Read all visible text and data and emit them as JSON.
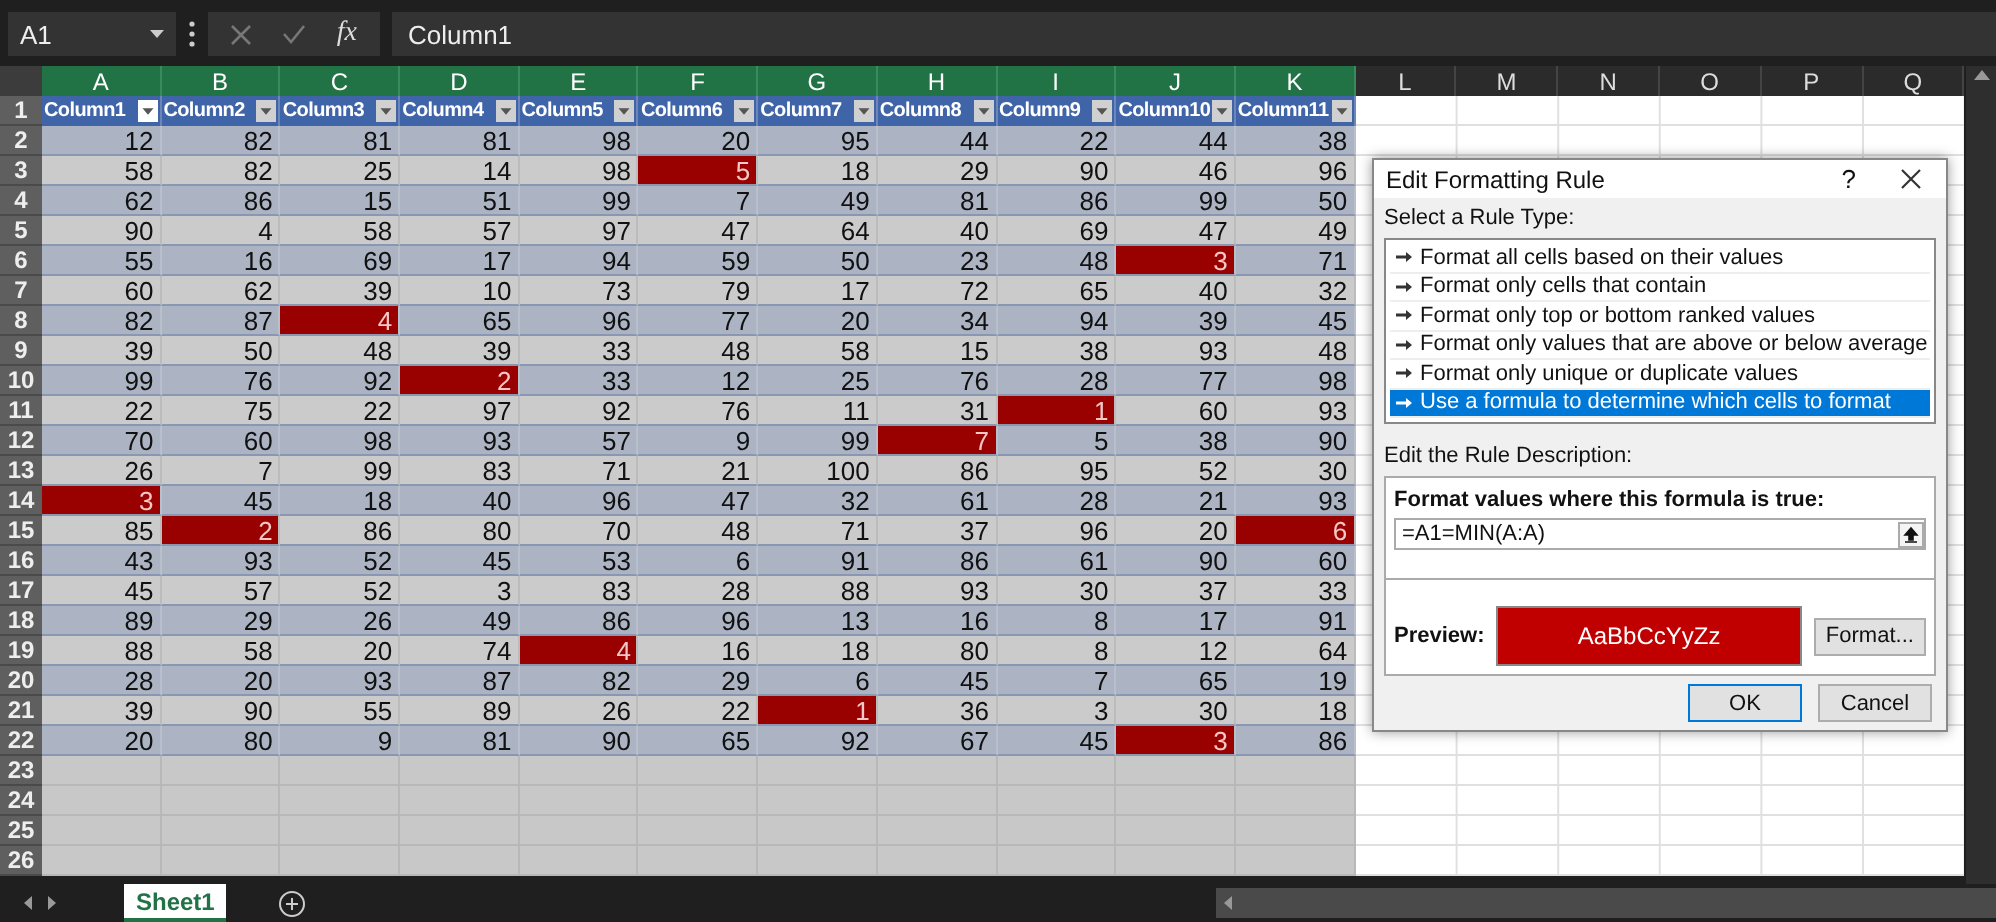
{
  "formula_bar": {
    "name_box": "A1",
    "function_label": "fx",
    "value": "Column1"
  },
  "column_headers": [
    {
      "label": "A",
      "selected": true
    },
    {
      "label": "B",
      "selected": true
    },
    {
      "label": "C",
      "selected": true
    },
    {
      "label": "D",
      "selected": true
    },
    {
      "label": "E",
      "selected": true
    },
    {
      "label": "F",
      "selected": true
    },
    {
      "label": "G",
      "selected": true
    },
    {
      "label": "H",
      "selected": true
    },
    {
      "label": "I",
      "selected": true
    },
    {
      "label": "J",
      "selected": true
    },
    {
      "label": "K",
      "selected": true
    },
    {
      "label": "L",
      "selected": false
    },
    {
      "label": "M",
      "selected": false
    },
    {
      "label": "N",
      "selected": false
    },
    {
      "label": "O",
      "selected": false
    },
    {
      "label": "P",
      "selected": false
    },
    {
      "label": "Q",
      "selected": false
    }
  ],
  "row_headers": [
    "1",
    "2",
    "3",
    "4",
    "5",
    "6",
    "7",
    "8",
    "9",
    "10",
    "11",
    "12",
    "13",
    "14",
    "15",
    "16",
    "17",
    "18",
    "19",
    "20",
    "21",
    "22",
    "23",
    "24",
    "25",
    "26"
  ],
  "table": {
    "columns": [
      "Column1",
      "Column2",
      "Column3",
      "Column4",
      "Column5",
      "Column6",
      "Column7",
      "Column8",
      "Column9",
      "Column10",
      "Column11"
    ],
    "rows": [
      {
        "cells": [
          {
            "value": "12",
            "highlighted": false
          },
          {
            "value": "82",
            "highlighted": false
          },
          {
            "value": "81",
            "highlighted": false
          },
          {
            "value": "81",
            "highlighted": false
          },
          {
            "value": "98",
            "highlighted": false
          },
          {
            "value": "20",
            "highlighted": false
          },
          {
            "value": "95",
            "highlighted": false
          },
          {
            "value": "44",
            "highlighted": false
          },
          {
            "value": "22",
            "highlighted": false
          },
          {
            "value": "44",
            "highlighted": false
          },
          {
            "value": "38",
            "highlighted": false
          }
        ]
      },
      {
        "cells": [
          {
            "value": "58",
            "highlighted": false
          },
          {
            "value": "82",
            "highlighted": false
          },
          {
            "value": "25",
            "highlighted": false
          },
          {
            "value": "14",
            "highlighted": false
          },
          {
            "value": "98",
            "highlighted": false
          },
          {
            "value": "5",
            "highlighted": true
          },
          {
            "value": "18",
            "highlighted": false
          },
          {
            "value": "29",
            "highlighted": false
          },
          {
            "value": "90",
            "highlighted": false
          },
          {
            "value": "46",
            "highlighted": false
          },
          {
            "value": "96",
            "highlighted": false
          }
        ]
      },
      {
        "cells": [
          {
            "value": "62",
            "highlighted": false
          },
          {
            "value": "86",
            "highlighted": false
          },
          {
            "value": "15",
            "highlighted": false
          },
          {
            "value": "51",
            "highlighted": false
          },
          {
            "value": "99",
            "highlighted": false
          },
          {
            "value": "7",
            "highlighted": false
          },
          {
            "value": "49",
            "highlighted": false
          },
          {
            "value": "81",
            "highlighted": false
          },
          {
            "value": "86",
            "highlighted": false
          },
          {
            "value": "99",
            "highlighted": false
          },
          {
            "value": "50",
            "highlighted": false
          }
        ]
      },
      {
        "cells": [
          {
            "value": "90",
            "highlighted": false
          },
          {
            "value": "4",
            "highlighted": false
          },
          {
            "value": "58",
            "highlighted": false
          },
          {
            "value": "57",
            "highlighted": false
          },
          {
            "value": "97",
            "highlighted": false
          },
          {
            "value": "47",
            "highlighted": false
          },
          {
            "value": "64",
            "highlighted": false
          },
          {
            "value": "40",
            "highlighted": false
          },
          {
            "value": "69",
            "highlighted": false
          },
          {
            "value": "47",
            "highlighted": false
          },
          {
            "value": "49",
            "highlighted": false
          }
        ]
      },
      {
        "cells": [
          {
            "value": "55",
            "highlighted": false
          },
          {
            "value": "16",
            "highlighted": false
          },
          {
            "value": "69",
            "highlighted": false
          },
          {
            "value": "17",
            "highlighted": false
          },
          {
            "value": "94",
            "highlighted": false
          },
          {
            "value": "59",
            "highlighted": false
          },
          {
            "value": "50",
            "highlighted": false
          },
          {
            "value": "23",
            "highlighted": false
          },
          {
            "value": "48",
            "highlighted": false
          },
          {
            "value": "3",
            "highlighted": true
          },
          {
            "value": "71",
            "highlighted": false
          }
        ]
      },
      {
        "cells": [
          {
            "value": "60",
            "highlighted": false
          },
          {
            "value": "62",
            "highlighted": false
          },
          {
            "value": "39",
            "highlighted": false
          },
          {
            "value": "10",
            "highlighted": false
          },
          {
            "value": "73",
            "highlighted": false
          },
          {
            "value": "79",
            "highlighted": false
          },
          {
            "value": "17",
            "highlighted": false
          },
          {
            "value": "72",
            "highlighted": false
          },
          {
            "value": "65",
            "highlighted": false
          },
          {
            "value": "40",
            "highlighted": false
          },
          {
            "value": "32",
            "highlighted": false
          }
        ]
      },
      {
        "cells": [
          {
            "value": "82",
            "highlighted": false
          },
          {
            "value": "87",
            "highlighted": false
          },
          {
            "value": "4",
            "highlighted": true
          },
          {
            "value": "65",
            "highlighted": false
          },
          {
            "value": "96",
            "highlighted": false
          },
          {
            "value": "77",
            "highlighted": false
          },
          {
            "value": "20",
            "highlighted": false
          },
          {
            "value": "34",
            "highlighted": false
          },
          {
            "value": "94",
            "highlighted": false
          },
          {
            "value": "39",
            "highlighted": false
          },
          {
            "value": "45",
            "highlighted": false
          }
        ]
      },
      {
        "cells": [
          {
            "value": "39",
            "highlighted": false
          },
          {
            "value": "50",
            "highlighted": false
          },
          {
            "value": "48",
            "highlighted": false
          },
          {
            "value": "39",
            "highlighted": false
          },
          {
            "value": "33",
            "highlighted": false
          },
          {
            "value": "48",
            "highlighted": false
          },
          {
            "value": "58",
            "highlighted": false
          },
          {
            "value": "15",
            "highlighted": false
          },
          {
            "value": "38",
            "highlighted": false
          },
          {
            "value": "93",
            "highlighted": false
          },
          {
            "value": "48",
            "highlighted": false
          }
        ]
      },
      {
        "cells": [
          {
            "value": "99",
            "highlighted": false
          },
          {
            "value": "76",
            "highlighted": false
          },
          {
            "value": "92",
            "highlighted": false
          },
          {
            "value": "2",
            "highlighted": true
          },
          {
            "value": "33",
            "highlighted": false
          },
          {
            "value": "12",
            "highlighted": false
          },
          {
            "value": "25",
            "highlighted": false
          },
          {
            "value": "76",
            "highlighted": false
          },
          {
            "value": "28",
            "highlighted": false
          },
          {
            "value": "77",
            "highlighted": false
          },
          {
            "value": "98",
            "highlighted": false
          }
        ]
      },
      {
        "cells": [
          {
            "value": "22",
            "highlighted": false
          },
          {
            "value": "75",
            "highlighted": false
          },
          {
            "value": "22",
            "highlighted": false
          },
          {
            "value": "97",
            "highlighted": false
          },
          {
            "value": "92",
            "highlighted": false
          },
          {
            "value": "76",
            "highlighted": false
          },
          {
            "value": "11",
            "highlighted": false
          },
          {
            "value": "31",
            "highlighted": false
          },
          {
            "value": "1",
            "highlighted": true
          },
          {
            "value": "60",
            "highlighted": false
          },
          {
            "value": "93",
            "highlighted": false
          }
        ]
      },
      {
        "cells": [
          {
            "value": "70",
            "highlighted": false
          },
          {
            "value": "60",
            "highlighted": false
          },
          {
            "value": "98",
            "highlighted": false
          },
          {
            "value": "93",
            "highlighted": false
          },
          {
            "value": "57",
            "highlighted": false
          },
          {
            "value": "9",
            "highlighted": false
          },
          {
            "value": "99",
            "highlighted": false
          },
          {
            "value": "7",
            "highlighted": true
          },
          {
            "value": "5",
            "highlighted": false
          },
          {
            "value": "38",
            "highlighted": false
          },
          {
            "value": "90",
            "highlighted": false
          }
        ]
      },
      {
        "cells": [
          {
            "value": "26",
            "highlighted": false
          },
          {
            "value": "7",
            "highlighted": false
          },
          {
            "value": "99",
            "highlighted": false
          },
          {
            "value": "83",
            "highlighted": false
          },
          {
            "value": "71",
            "highlighted": false
          },
          {
            "value": "21",
            "highlighted": false
          },
          {
            "value": "100",
            "highlighted": false
          },
          {
            "value": "86",
            "highlighted": false
          },
          {
            "value": "95",
            "highlighted": false
          },
          {
            "value": "52",
            "highlighted": false
          },
          {
            "value": "30",
            "highlighted": false
          }
        ]
      },
      {
        "cells": [
          {
            "value": "3",
            "highlighted": true
          },
          {
            "value": "45",
            "highlighted": false
          },
          {
            "value": "18",
            "highlighted": false
          },
          {
            "value": "40",
            "highlighted": false
          },
          {
            "value": "96",
            "highlighted": false
          },
          {
            "value": "47",
            "highlighted": false
          },
          {
            "value": "32",
            "highlighted": false
          },
          {
            "value": "61",
            "highlighted": false
          },
          {
            "value": "28",
            "highlighted": false
          },
          {
            "value": "21",
            "highlighted": false
          },
          {
            "value": "93",
            "highlighted": false
          }
        ]
      },
      {
        "cells": [
          {
            "value": "85",
            "highlighted": false
          },
          {
            "value": "2",
            "highlighted": true
          },
          {
            "value": "86",
            "highlighted": false
          },
          {
            "value": "80",
            "highlighted": false
          },
          {
            "value": "70",
            "highlighted": false
          },
          {
            "value": "48",
            "highlighted": false
          },
          {
            "value": "71",
            "highlighted": false
          },
          {
            "value": "37",
            "highlighted": false
          },
          {
            "value": "96",
            "highlighted": false
          },
          {
            "value": "20",
            "highlighted": false
          },
          {
            "value": "6",
            "highlighted": true
          }
        ]
      },
      {
        "cells": [
          {
            "value": "43",
            "highlighted": false
          },
          {
            "value": "93",
            "highlighted": false
          },
          {
            "value": "52",
            "highlighted": false
          },
          {
            "value": "45",
            "highlighted": false
          },
          {
            "value": "53",
            "highlighted": false
          },
          {
            "value": "6",
            "highlighted": false
          },
          {
            "value": "91",
            "highlighted": false
          },
          {
            "value": "86",
            "highlighted": false
          },
          {
            "value": "61",
            "highlighted": false
          },
          {
            "value": "90",
            "highlighted": false
          },
          {
            "value": "60",
            "highlighted": false
          }
        ]
      },
      {
        "cells": [
          {
            "value": "45",
            "highlighted": false
          },
          {
            "value": "57",
            "highlighted": false
          },
          {
            "value": "52",
            "highlighted": false
          },
          {
            "value": "3",
            "highlighted": false
          },
          {
            "value": "83",
            "highlighted": false
          },
          {
            "value": "28",
            "highlighted": false
          },
          {
            "value": "88",
            "highlighted": false
          },
          {
            "value": "93",
            "highlighted": false
          },
          {
            "value": "30",
            "highlighted": false
          },
          {
            "value": "37",
            "highlighted": false
          },
          {
            "value": "33",
            "highlighted": false
          }
        ]
      },
      {
        "cells": [
          {
            "value": "89",
            "highlighted": false
          },
          {
            "value": "29",
            "highlighted": false
          },
          {
            "value": "26",
            "highlighted": false
          },
          {
            "value": "49",
            "highlighted": false
          },
          {
            "value": "86",
            "highlighted": false
          },
          {
            "value": "96",
            "highlighted": false
          },
          {
            "value": "13",
            "highlighted": false
          },
          {
            "value": "16",
            "highlighted": false
          },
          {
            "value": "8",
            "highlighted": false
          },
          {
            "value": "17",
            "highlighted": false
          },
          {
            "value": "91",
            "highlighted": false
          }
        ]
      },
      {
        "cells": [
          {
            "value": "88",
            "highlighted": false
          },
          {
            "value": "58",
            "highlighted": false
          },
          {
            "value": "20",
            "highlighted": false
          },
          {
            "value": "74",
            "highlighted": false
          },
          {
            "value": "4",
            "highlighted": true
          },
          {
            "value": "16",
            "highlighted": false
          },
          {
            "value": "18",
            "highlighted": false
          },
          {
            "value": "80",
            "highlighted": false
          },
          {
            "value": "8",
            "highlighted": false
          },
          {
            "value": "12",
            "highlighted": false
          },
          {
            "value": "64",
            "highlighted": false
          }
        ]
      },
      {
        "cells": [
          {
            "value": "28",
            "highlighted": false
          },
          {
            "value": "20",
            "highlighted": false
          },
          {
            "value": "93",
            "highlighted": false
          },
          {
            "value": "87",
            "highlighted": false
          },
          {
            "value": "82",
            "highlighted": false
          },
          {
            "value": "29",
            "highlighted": false
          },
          {
            "value": "6",
            "highlighted": false
          },
          {
            "value": "45",
            "highlighted": false
          },
          {
            "value": "7",
            "highlighted": false
          },
          {
            "value": "65",
            "highlighted": false
          },
          {
            "value": "19",
            "highlighted": false
          }
        ]
      },
      {
        "cells": [
          {
            "value": "39",
            "highlighted": false
          },
          {
            "value": "90",
            "highlighted": false
          },
          {
            "value": "55",
            "highlighted": false
          },
          {
            "value": "89",
            "highlighted": false
          },
          {
            "value": "26",
            "highlighted": false
          },
          {
            "value": "22",
            "highlighted": false
          },
          {
            "value": "1",
            "highlighted": true
          },
          {
            "value": "36",
            "highlighted": false
          },
          {
            "value": "3",
            "highlighted": false
          },
          {
            "value": "30",
            "highlighted": false
          },
          {
            "value": "18",
            "highlighted": false
          }
        ]
      },
      {
        "cells": [
          {
            "value": "20",
            "highlighted": false
          },
          {
            "value": "80",
            "highlighted": false
          },
          {
            "value": "9",
            "highlighted": false
          },
          {
            "value": "81",
            "highlighted": false
          },
          {
            "value": "90",
            "highlighted": false
          },
          {
            "value": "65",
            "highlighted": false
          },
          {
            "value": "92",
            "highlighted": false
          },
          {
            "value": "67",
            "highlighted": false
          },
          {
            "value": "45",
            "highlighted": false
          },
          {
            "value": "3",
            "highlighted": true
          },
          {
            "value": "86",
            "highlighted": false
          }
        ]
      }
    ]
  },
  "sheet_tabs": [
    {
      "label": "Sheet1",
      "selected": true
    }
  ],
  "dialog": {
    "title": "Edit Formatting Rule",
    "help": "?",
    "rule_type_label": "Select a Rule Type:",
    "rule_types": [
      {
        "label": "Format all cells based on their values",
        "selected": false
      },
      {
        "label": "Format only cells that contain",
        "selected": false
      },
      {
        "label": "Format only top or bottom ranked values",
        "selected": false
      },
      {
        "label": "Format only values that are above or below average",
        "selected": false
      },
      {
        "label": "Format only unique or duplicate values",
        "selected": false
      },
      {
        "label": "Use a formula to determine which cells to format",
        "selected": true
      }
    ],
    "description_label": "Edit the Rule Description:",
    "formula_label": "Format values where this formula is true:",
    "formula": "=A1=MIN(A:A)",
    "preview_label": "Preview:",
    "preview_text": "AaBbCcYyZz",
    "format_button": "Format...",
    "ok_button": "OK",
    "cancel_button": "Cancel"
  }
}
